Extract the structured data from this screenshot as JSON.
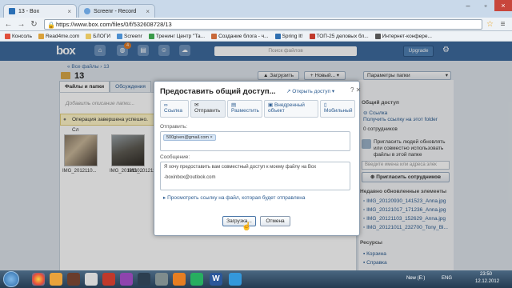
{
  "browser": {
    "tabs": [
      {
        "label": "13 - Box"
      },
      {
        "label": "Screenr - Record"
      }
    ],
    "address": "https://www.box.com/files/0/f/532608728/13",
    "bookmarks": [
      "Консоль",
      "Read4me.com",
      "БЛОГИ",
      "Screenr",
      "Тренинг Центр \"Та...",
      "Создание блога - ч...",
      "Spring It!",
      "ТОП-25 деловых бл...",
      "Интернет-конфере..."
    ]
  },
  "box_header": {
    "logo": "box",
    "notifications_count": "4",
    "search_placeholder": "Поиск файлов",
    "upgrade_label": "Upgrade"
  },
  "page": {
    "breadcrumb": "« Все файлы › 13",
    "folder_title": "13",
    "upload_label": "Загрузить",
    "new_label": "Новый...",
    "folder_params_label": "Параметры папки",
    "subtabs": [
      "Файлы и папки",
      "Обсуждения"
    ],
    "description_hint": "Добавить описание папки...",
    "notification": "Операция завершена успешно. Сл",
    "thumbnails": [
      "IMG_2012110...",
      "IMG_2012110...",
      "IMG_2012110..."
    ]
  },
  "right_panel": {
    "shared_heading": "Общий доступ",
    "link_label": "Ссылка",
    "get_link": "Получить ссылку на этот folder",
    "collaborators": "0 сотрудников",
    "invite_text": [
      "Пригласить людей обновлять",
      "или совместно использовать",
      "файлы в этой папке"
    ],
    "invite_input_placeholder": "Введите имена или адреса элек",
    "invite_button": "Пригласить сотрудников",
    "recent_heading": "Недавно обновленные элементы",
    "recent_files": [
      "IMG_20120930_141523_Anna.jpg",
      "IMG_20121017_171236_Anna.jpg",
      "IMG_20121103_152629_Anna.jpg",
      "IMG_20121011_232700_Tony_Bl..."
    ],
    "resources_heading": "Ресурсы",
    "resources": [
      "Корзина",
      "Справка"
    ]
  },
  "modal": {
    "title": "Предоставить общий доступ...",
    "open_access": "Открыть доступ",
    "tabs": [
      {
        "label": "Ссылка"
      },
      {
        "label": "Отправить"
      },
      {
        "label": "Разместить"
      },
      {
        "label": "Внедренный объект"
      },
      {
        "label": "Мобильный"
      }
    ],
    "send_label": "Отправить:",
    "recipient_chip": "500given@gmail.com ×",
    "message_label": "Сообщение:",
    "message_line1": "Я хочу предоставить вам совместный доступ к моему файлу на Box",
    "message_line2": "-boxinbox@outlook.com",
    "preview_link": "Просмотреть ссылку на файл, которая будет отправлена",
    "submit_label": "Загрузка...",
    "cancel_label": "Отмена"
  },
  "taskbar": {
    "lang": "ENG",
    "drive": "New (E:)",
    "time": "23:50",
    "date": "12.12.2012"
  }
}
